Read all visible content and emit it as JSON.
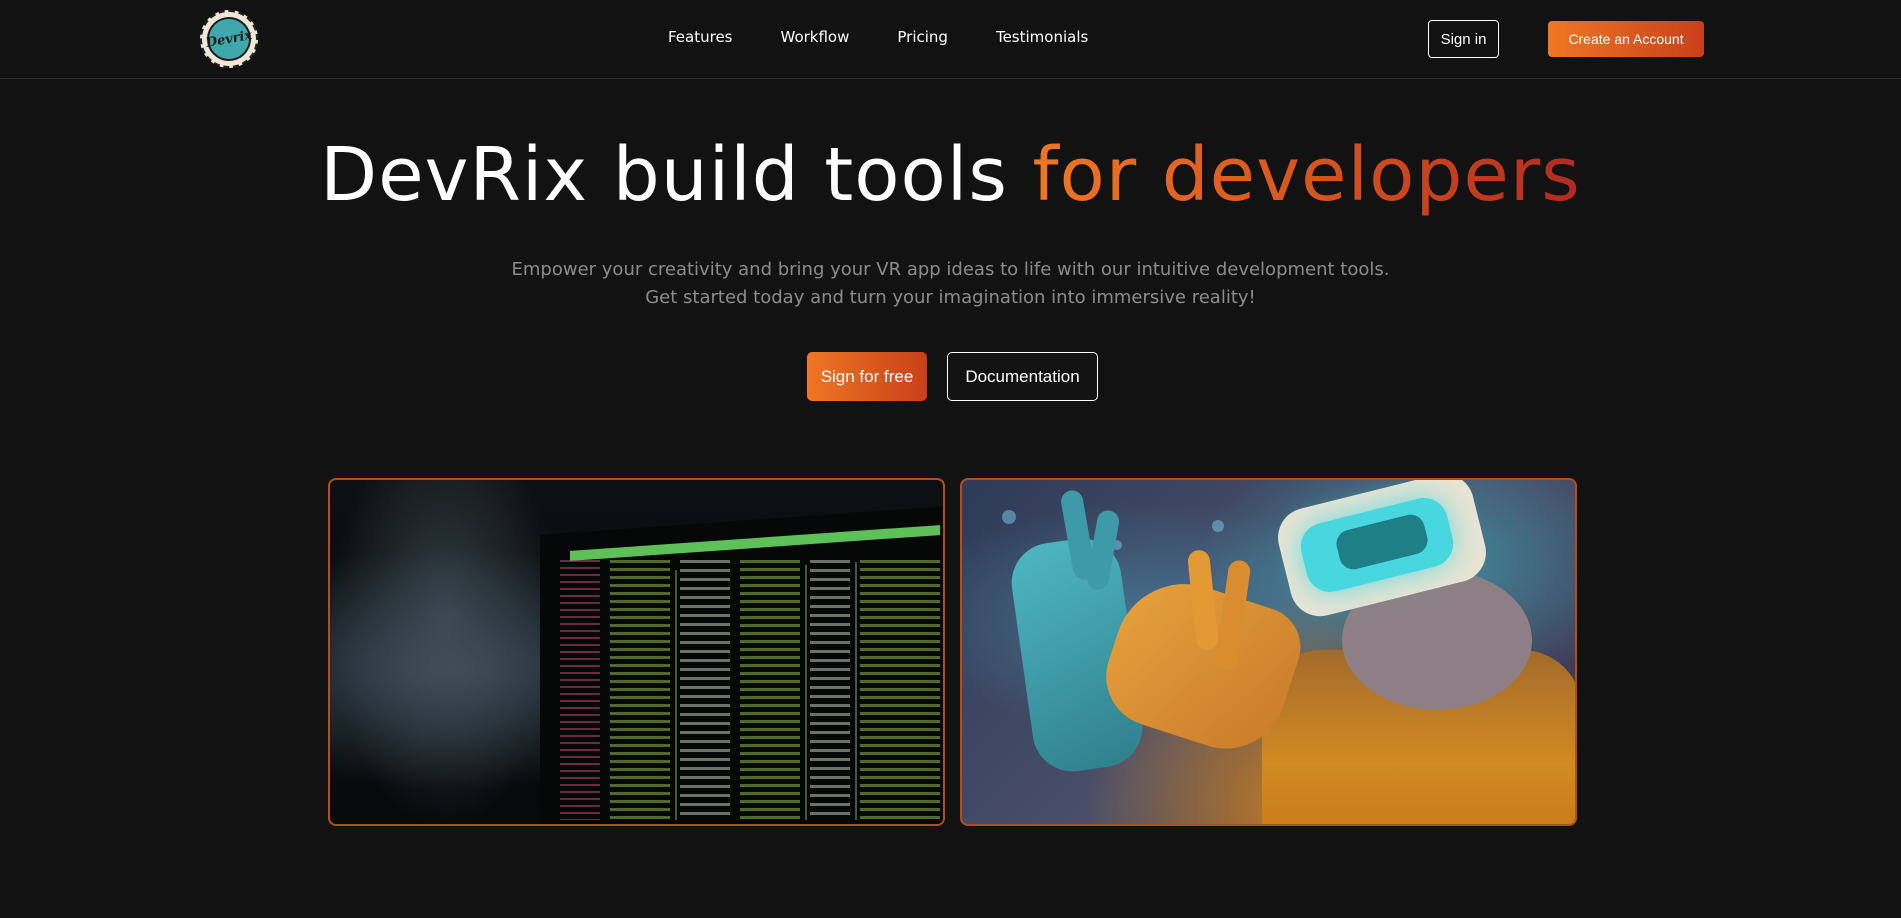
{
  "brand": {
    "logo_text": "Devrix"
  },
  "nav": {
    "links": [
      "Features",
      "Workflow",
      "Pricing",
      "Testimonials"
    ],
    "sign_in_label": "Sign in",
    "create_account_label": "Create an Account"
  },
  "hero": {
    "title_main": "DevRix build tools ",
    "title_accent": "for developers",
    "subtitle_line1": "Empower your creativity and bring your VR app ideas to life with our intuitive development tools.",
    "subtitle_line2": "Get started today and turn your imagination into immersive reality!",
    "primary_cta_label": "Sign for free",
    "secondary_cta_label": "Documentation"
  },
  "colors": {
    "background": "#121212",
    "accent_start": "#f07623",
    "accent_end": "#b12a22",
    "card_border": "#b34f1d",
    "subtitle": "#8c8c8c"
  },
  "images": [
    {
      "name": "terminal-screen-photo"
    },
    {
      "name": "vr-headset-person-photo"
    }
  ]
}
